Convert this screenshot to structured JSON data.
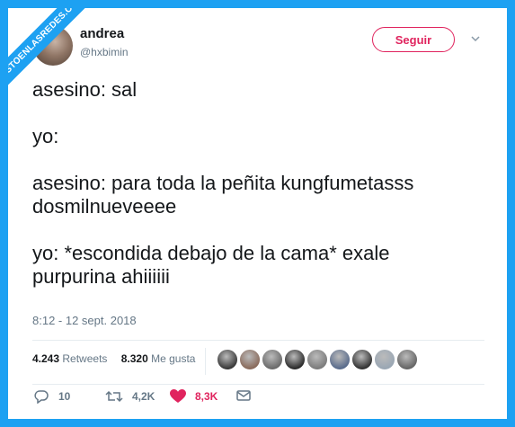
{
  "watermark": "VISTOENLASREDES.COM",
  "user": {
    "name": "andrea",
    "handle": "@hxbimin"
  },
  "follow_label": "Seguir",
  "tweet_lines": [
    "asesino: sal",
    "",
    "yo:",
    "",
    "asesino: para toda la peñita kungfumetasss",
    "dosmilnueveeee",
    "",
    "yo: *escondida debajo de la cama* exale",
    "purpurina ahiiiiii"
  ],
  "timestamp": "8:12 - 12 sept. 2018",
  "stats": {
    "retweets_count": "4.243",
    "retweets_label": "Retweets",
    "likes_count": "8.320",
    "likes_label": "Me gusta"
  },
  "likers": [
    "#3a3a3a",
    "#8a6b5c",
    "#6b6b6b",
    "#2c2c2c",
    "#7c7c7c",
    "#5a6c8c",
    "#333333",
    "#9aa7b4",
    "#666666"
  ],
  "actions": {
    "replies": "10",
    "retweets": "4,2K",
    "likes": "8,3K"
  },
  "colors": {
    "accent": "#1da1f2",
    "like": "#e0245e",
    "muted": "#657786"
  }
}
